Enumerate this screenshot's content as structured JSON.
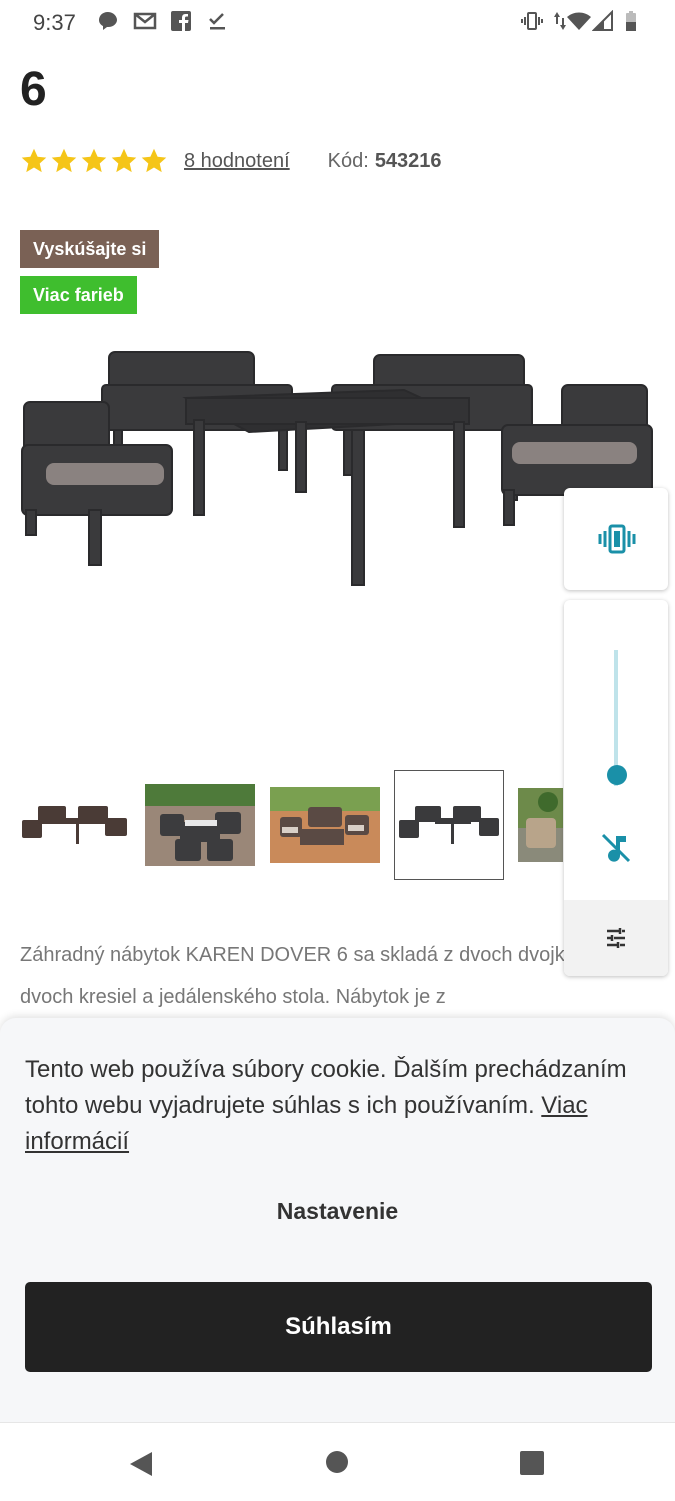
{
  "status_bar": {
    "time": "9:37"
  },
  "product": {
    "title_fragment": "6",
    "rating_link": "8 hodnotení",
    "code_label": "Kód:",
    "code_value": "543216",
    "badges": [
      "Vyskúšajte si",
      "Viac farieb"
    ],
    "rating_stars": 5,
    "description": "Záhradný nábytok KAREN DOVER 6 sa skladá z dvoch dvojkresiel, dvoch kresiel a jedálenského stola. Nábytok je z"
  },
  "cookie_banner": {
    "text": "Tento web používa súbory cookie. Ďalším prechádzaním tohto webu vyjadrujete súhlas s ich používaním.",
    "more_link": "Viac informácií",
    "settings_label": "Nastavenie",
    "agree_label": "Súhlasím"
  },
  "volume_panel": {
    "level": 0.08,
    "icons": [
      "vibrate-icon",
      "music-off-icon",
      "equalizer-settings-icon"
    ]
  },
  "colors": {
    "badge_try": "#7a6155",
    "badge_colors": "#3fbe2e",
    "star": "#f5c518",
    "accent": "#1a90a8",
    "agree_button": "#222222"
  }
}
